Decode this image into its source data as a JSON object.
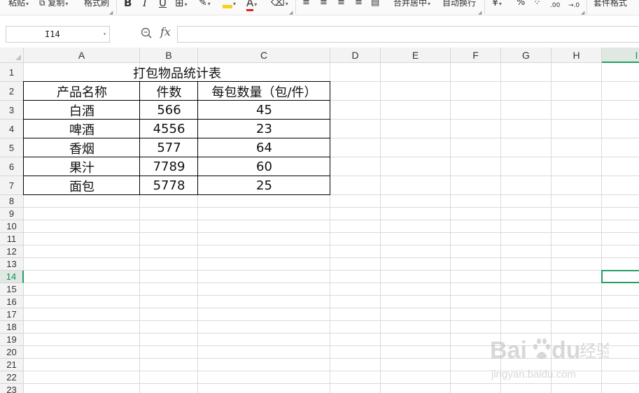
{
  "ribbon": {
    "paste": "粘贴",
    "copy": "复制",
    "format_painter": "格式刷",
    "bold": "B",
    "italic": "I",
    "underline": "U",
    "font_color": "A",
    "merge_center": "合并居中",
    "wrap_text": "自动换行",
    "percent": "%",
    "decimal_add": ".00",
    "decimal_remove": "→.0",
    "table_style": "套件格式"
  },
  "formula_bar": {
    "name_box": "I14",
    "fx_label": "fx",
    "formula": ""
  },
  "columns": [
    "A",
    "B",
    "C",
    "D",
    "E",
    "F",
    "G",
    "H",
    "I"
  ],
  "rows": [
    "1",
    "2",
    "3",
    "4",
    "5",
    "6",
    "7",
    "8",
    "9",
    "10",
    "11",
    "12",
    "13",
    "14",
    "15",
    "16",
    "17",
    "18",
    "19",
    "20",
    "21",
    "22",
    "23"
  ],
  "active_cell": {
    "column": "I",
    "row": "14"
  },
  "sheet": {
    "title": "打包物品统计表",
    "headers": [
      "产品名称",
      "件数",
      "每包数量（包/件）"
    ],
    "rows": [
      [
        "白酒",
        "566",
        "45"
      ],
      [
        "啤酒",
        "4556",
        "23"
      ],
      [
        "香烟",
        "577",
        "64"
      ],
      [
        "果汁",
        "7789",
        "60"
      ],
      [
        "面包",
        "5778",
        "25"
      ]
    ]
  },
  "watermark": {
    "brand": "Baidu 经验",
    "url": "jingyan.baidu.com"
  }
}
